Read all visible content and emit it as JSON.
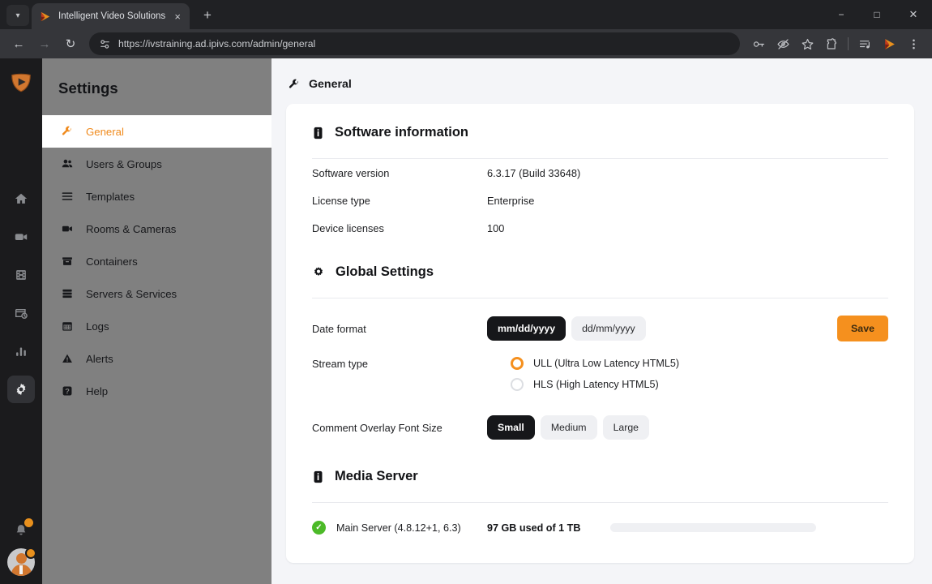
{
  "browser": {
    "tab": {
      "title": "Intelligent Video Solutions",
      "favicon": "ivs-play-logo-icon",
      "close": "×"
    },
    "tab_list_chevron": "▾",
    "new_tab": "+",
    "nav": {
      "back": "←",
      "forward": "→",
      "reload": "↻"
    },
    "omnibox": {
      "site_info_icon": "site-settings-icon",
      "url": "https://ivstraining.ad.ipivs.com/admin/general"
    },
    "toolbar_icons": [
      {
        "name": "password-key-icon"
      },
      {
        "name": "hide-password-icon"
      },
      {
        "name": "bookmark-star-icon"
      },
      {
        "name": "extensions-puzzle-icon"
      },
      {
        "name": "playlist-icon"
      },
      {
        "name": "ivs-play-logo-icon"
      },
      {
        "name": "browser-menu-icon"
      }
    ],
    "window_controls": {
      "minimize": "−",
      "maximize": "□",
      "close": "✕"
    }
  },
  "rail": {
    "logo": "ivs-shield-logo-icon",
    "items": [
      {
        "name": "home",
        "icon": "home-icon",
        "active": false
      },
      {
        "name": "video",
        "icon": "video-camera-icon",
        "active": false
      },
      {
        "name": "media",
        "icon": "film-strip-icon",
        "active": false
      },
      {
        "name": "scheduling",
        "icon": "card-clock-icon",
        "active": false
      },
      {
        "name": "analytics",
        "icon": "bar-chart-icon",
        "active": false
      },
      {
        "name": "settings",
        "icon": "gear-icon",
        "active": true
      }
    ],
    "notifications_icon": "bell-icon",
    "avatar": "user-avatar"
  },
  "sidebar": {
    "title": "Settings",
    "items": [
      {
        "label": "General",
        "icon": "wrench-icon",
        "active": true
      },
      {
        "label": "Users & Groups",
        "icon": "users-icon",
        "active": false
      },
      {
        "label": "Templates",
        "icon": "list-icon",
        "active": false
      },
      {
        "label": "Rooms & Cameras",
        "icon": "video-camera-icon",
        "active": false
      },
      {
        "label": "Containers",
        "icon": "box-icon",
        "active": false
      },
      {
        "label": "Servers & Services",
        "icon": "server-icon",
        "active": false
      },
      {
        "label": "Logs",
        "icon": "calendar-icon",
        "active": false
      },
      {
        "label": "Alerts",
        "icon": "warning-triangle-icon",
        "active": false
      },
      {
        "label": "Help",
        "icon": "question-mark-icon",
        "active": false
      }
    ]
  },
  "page": {
    "header": {
      "icon": "wrench-icon",
      "title": "General"
    },
    "software_information": {
      "icon": "info-icon",
      "title": "Software information",
      "rows": [
        {
          "label": "Software version",
          "value": "6.3.17 (Build 33648)"
        },
        {
          "label": "License type",
          "value": "Enterprise"
        },
        {
          "label": "Device licenses",
          "value": "100"
        }
      ]
    },
    "global_settings": {
      "icon": "gear-icon",
      "title": "Global Settings",
      "date_format": {
        "label": "Date format",
        "options": [
          {
            "label": "mm/dd/yyyy",
            "selected": true
          },
          {
            "label": "dd/mm/yyyy",
            "selected": false
          }
        ],
        "save_label": "Save"
      },
      "stream_type": {
        "label": "Stream type",
        "options": [
          {
            "label": "ULL (Ultra Low Latency HTML5)",
            "selected": true
          },
          {
            "label": "HLS (High Latency HTML5)",
            "selected": false
          }
        ]
      },
      "font_size": {
        "label": "Comment Overlay Font Size",
        "options": [
          {
            "label": "Small",
            "selected": true
          },
          {
            "label": "Medium",
            "selected": false
          },
          {
            "label": "Large",
            "selected": false
          }
        ]
      }
    },
    "media_server": {
      "icon": "info-icon",
      "title": "Media Server",
      "server": {
        "status_icon": "check-circle-icon",
        "name": "Main Server (4.8.12+1, 6.3)",
        "usage": "97 GB used of 1 TB",
        "progress_percent": 9.7
      }
    }
  },
  "colors": {
    "accent": "#f5901e",
    "sidebar": "#808080",
    "rail": "#1b1b1d",
    "page_bg": "#f4f5f8",
    "status_ok": "#4cba28"
  }
}
